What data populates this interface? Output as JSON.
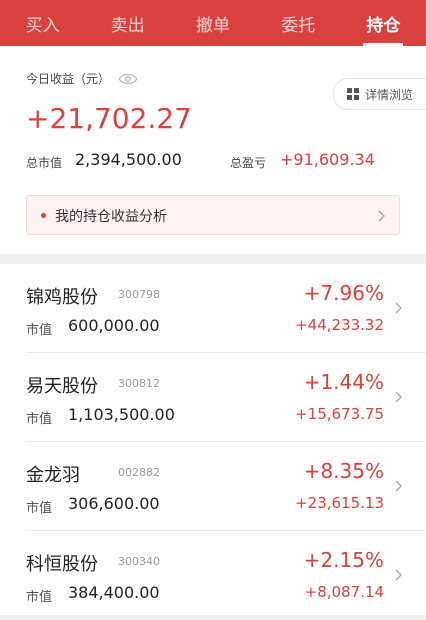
{
  "tabs": [
    {
      "label": "买入"
    },
    {
      "label": "卖出"
    },
    {
      "label": "撤单"
    },
    {
      "label": "委托"
    },
    {
      "label": "持仓",
      "active": true
    }
  ],
  "summary": {
    "today_label": "今日收益（元）",
    "today_value": "+21,702.27",
    "detail_button": "详情浏览",
    "total_market_value_label": "总市值",
    "total_market_value": "2,394,500.00",
    "total_pl_label": "总盈亏",
    "total_pl": "+91,609.34",
    "analysis_text": "我的持仓收益分析"
  },
  "holdings": [
    {
      "name": "锦鸡股份",
      "code": "300798",
      "mv_label": "市值",
      "market_value": "600,000.00",
      "pct": "+7.96%",
      "pl": "+44,233.32"
    },
    {
      "name": "易天股份",
      "code": "300812",
      "mv_label": "市值",
      "market_value": "1,103,500.00",
      "pct": "+1.44%",
      "pl": "+15,673.75"
    },
    {
      "name": "金龙羽",
      "code": "002882",
      "mv_label": "市值",
      "market_value": "306,600.00",
      "pct": "+8.35%",
      "pl": "+23,615.13"
    },
    {
      "name": "科恒股份",
      "code": "300340",
      "mv_label": "市值",
      "market_value": "384,400.00",
      "pct": "+2.15%",
      "pl": "+8,087.14"
    }
  ],
  "colors": {
    "accent": "#d9413f",
    "gain": "#d9413f"
  },
  "icons": [
    "eye-icon",
    "grid-icon",
    "chevron-right-icon",
    "dot-icon"
  ]
}
